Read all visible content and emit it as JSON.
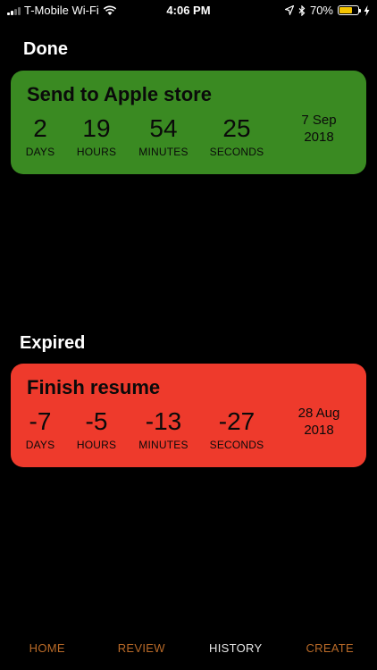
{
  "status_bar": {
    "carrier": "T-Mobile Wi-Fi",
    "time": "4:06 PM",
    "battery_percent": "70%",
    "battery_level": 0.7
  },
  "sections": {
    "done": "Done",
    "expired": "Expired"
  },
  "cards": [
    {
      "title": "Send to Apple store",
      "days": "2",
      "hours": "19",
      "minutes": "54",
      "seconds": "25",
      "date_line1": "7 Sep",
      "date_line2": "2018",
      "color": "#3a8a22"
    },
    {
      "title": "Finish resume",
      "days": "-7",
      "hours": "-5",
      "minutes": "-13",
      "seconds": "-27",
      "date_line1": "28 Aug",
      "date_line2": "2018",
      "color": "#ee3a2c"
    }
  ],
  "labels": {
    "days": "DAYS",
    "hours": "HOURS",
    "minutes": "MINUTES",
    "seconds": "SECONDS"
  },
  "tabs": {
    "home": "HOME",
    "review": "REVIEW",
    "history": "HISTORY",
    "create": "CREATE",
    "active_color": "#e8e8e8",
    "inactive_color": "#b96a28"
  }
}
